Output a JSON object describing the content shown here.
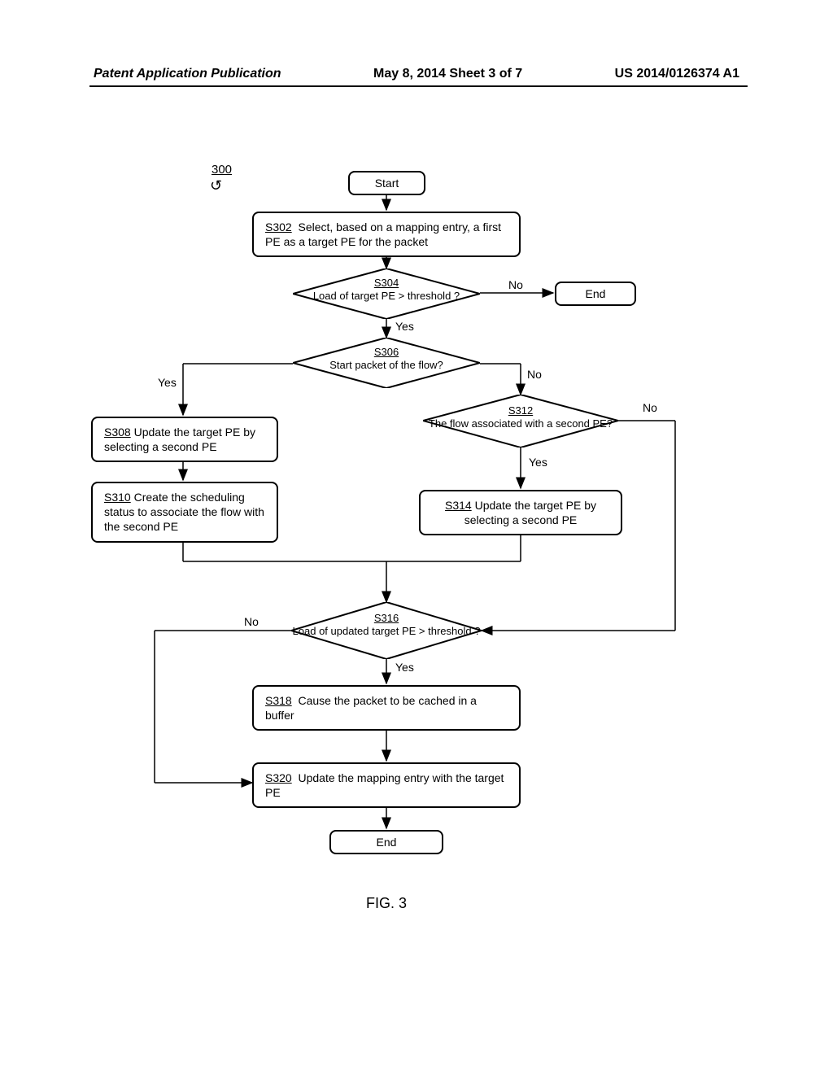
{
  "header": {
    "left": "Patent Application Publication",
    "center": "May 8, 2014  Sheet 3 of 7",
    "right": "US 2014/0126374 A1"
  },
  "figure": {
    "ref": "300",
    "caption": "FIG. 3"
  },
  "terminals": {
    "start": "Start",
    "end1": "End",
    "end2": "End"
  },
  "steps": {
    "s302": {
      "id": "S302",
      "text": "Select, based on a mapping entry, a first PE as a target PE for the packet"
    },
    "s304": {
      "id": "S304",
      "text": "Load of target PE > threshold ?"
    },
    "s306": {
      "id": "S306",
      "text": "Start packet of the flow?"
    },
    "s308": {
      "id": "S308",
      "text": "Update the target PE by selecting a second PE"
    },
    "s310": {
      "id": "S310",
      "text": "Create the scheduling status to associate the flow with the second PE"
    },
    "s312": {
      "id": "S312",
      "text": "The flow associated with a second PE?"
    },
    "s314": {
      "id": "S314",
      "text": "Update the target PE by selecting a second PE"
    },
    "s316": {
      "id": "S316",
      "text": "Load of updated target PE > threshold ?"
    },
    "s318": {
      "id": "S318",
      "text": "Cause the packet to be cached in a buffer"
    },
    "s320": {
      "id": "S320",
      "text": "Update the mapping entry with the target PE"
    }
  },
  "labels": {
    "yes": "Yes",
    "no": "No"
  }
}
